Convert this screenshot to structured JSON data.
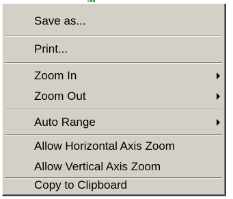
{
  "context_menu": {
    "items": [
      {
        "label": "Save as...",
        "submenu": false
      },
      {
        "label": "Print...",
        "submenu": false
      },
      {
        "label": "Zoom In",
        "submenu": true
      },
      {
        "label": "Zoom Out",
        "submenu": true
      },
      {
        "label": "Auto Range",
        "submenu": true
      },
      {
        "label": "Allow Horizontal Axis Zoom",
        "submenu": false
      },
      {
        "label": "Allow Vertical Axis Zoom",
        "submenu": false
      },
      {
        "label": "Copy to Clipboard",
        "submenu": false
      }
    ],
    "submenu_icon": "triangle-right-icon"
  },
  "colors": {
    "menu_background": "#d4d0c8",
    "text": "#000000",
    "separator_shadow": "#808080",
    "separator_highlight": "#ffffff"
  }
}
